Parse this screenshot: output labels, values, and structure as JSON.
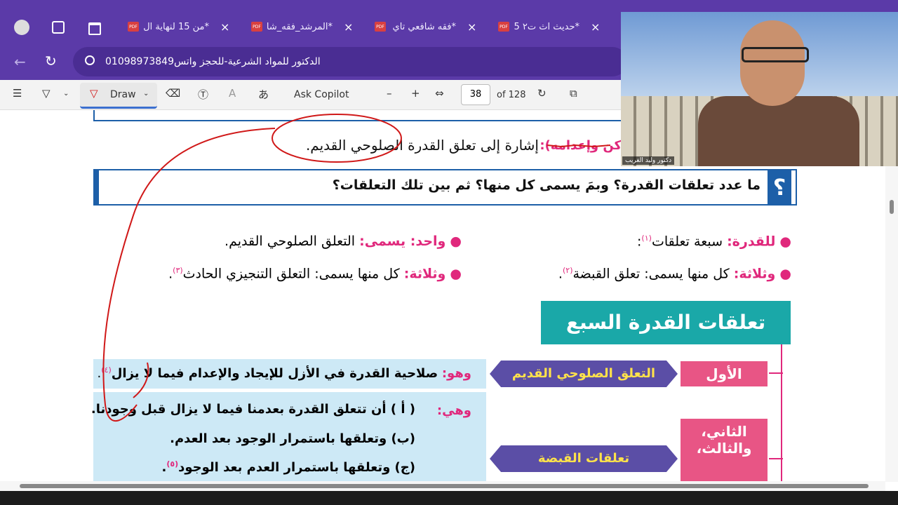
{
  "tabs": [
    {
      "label": "*من 15 لنهاية ال"
    },
    {
      "label": "*المرشد_فقه_شا"
    },
    {
      "label": "*فقه شافعي تاي"
    },
    {
      "label": "*حديث اث ت٢ 5"
    }
  ],
  "address": {
    "text": "الدكتور للمواد الشرعية-للحجز واتس01098973849"
  },
  "toolbar": {
    "draw": "Draw",
    "ask": "Ask Copilot",
    "page": "38",
    "of": "of 128",
    "minus": "–",
    "plus": "+"
  },
  "doc": {
    "top_label": "كن وإعدامه):",
    "top_text": "إشارة إلى تعلق القدرة الصلوحي القديم.",
    "question": "ما عدد تعلقات القدرة؟ وبمَ يسمى كل منها؟ ثم بين تلك التعلقات؟",
    "q_mark": "؟",
    "b1_label": "للقدرة:",
    "b1_text": "سبعة تعلقات",
    "b1_sup": "(١)",
    "b1_end": ":",
    "b2_label": "واحد: يسمى:",
    "b2_text": "التعلق الصلوحي القديم.",
    "b3_label": "وثلاثة:",
    "b3_text": "كل منها يسمى: تعلق القبضة",
    "b3_sup": "(٢)",
    "b3_end": ".",
    "b4_label": "وثلاثة:",
    "b4_text": "كل منها يسمى: التعلق التنجيزي الحادث",
    "b4_sup": "(٣)",
    "b4_end": ".",
    "banner": "تعلقات القدرة السبع",
    "first": "الأول",
    "first_name": "التعلق الصلوحي القديم",
    "first_label": "وهو:",
    "first_text": "صلاحية القدرة في الأزل للإيجاد والإعدام فيما لا يزال",
    "first_sup": "(٤)",
    "first_end": ".",
    "second": "الثاني،",
    "third": "والثالث،",
    "second_name": "تعلقات القبضة",
    "second_label": "وهي:",
    "line_a": "( أ ) أن تتعلق القدرة بعدمنا فيما لا يزال قبل وجودنا.",
    "line_b": "(ب) وتعلقها باستمرار الوجود بعد العدم.",
    "line_c": "(ج) وتعلقها باستمرار العدم بعد الوجود",
    "line_c_sup": "(٥)",
    "line_c_end": "."
  },
  "webcam": {
    "caption": "دكتور وليد الغريب"
  },
  "colors": {
    "tab_bg": "#5b3aa8",
    "magenta": "#e0287c",
    "teal": "#1aa8a8",
    "purple": "#5b4ea6",
    "blue": "#1d5fa8",
    "ink": "#d01818",
    "light_blue": "#cde9f6"
  }
}
